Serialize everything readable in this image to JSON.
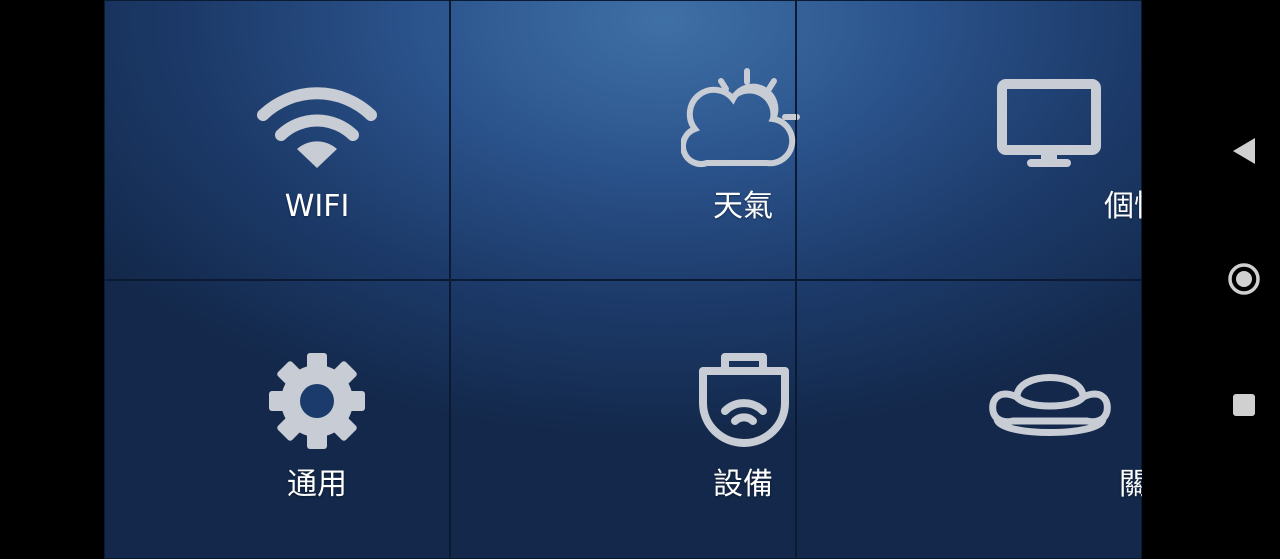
{
  "tiles": [
    {
      "label": "WIFI",
      "icon": "wifi-icon"
    },
    {
      "label": "天氣",
      "icon": "weather-icon"
    },
    {
      "label": "個性化",
      "icon": "monitor-icon"
    },
    {
      "label": "通用",
      "icon": "gear-icon"
    },
    {
      "label": "設備",
      "icon": "device-icon"
    },
    {
      "label": "關於",
      "icon": "sofa-icon"
    }
  ],
  "nav": {
    "back": "back-icon",
    "home": "home-icon",
    "recents": "recents-icon"
  },
  "colors": {
    "tile_bg": "#1f4478",
    "icon": "#c8ccd4",
    "label": "#ffffff",
    "nav": "#d0d0d0"
  }
}
